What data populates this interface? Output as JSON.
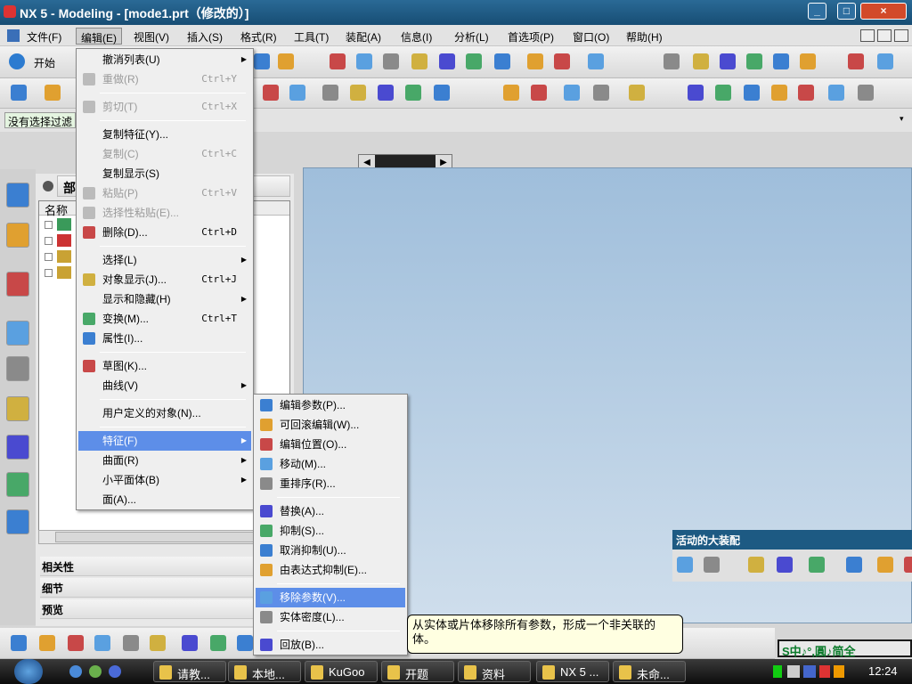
{
  "window": {
    "title": "NX 5 - Modeling - [mode1.prt（修改的）]",
    "controls": [
      "_",
      "□",
      "×"
    ]
  },
  "menubar": {
    "items": [
      "文件(F)",
      "编辑(E)",
      "视图(V)",
      "插入(S)",
      "格式(R)",
      "工具(T)",
      "装配(A)",
      "信息(I)",
      "分析(L)",
      "首选项(P)",
      "窗口(O)",
      "帮助(H)"
    ],
    "active": 1
  },
  "toolbar": {
    "start_label": "开始",
    "filter_text": "没有选择过滤"
  },
  "navigator": {
    "header": "部",
    "column": "名称",
    "sections": [
      "相关性",
      "细节",
      "预览"
    ]
  },
  "edit_menu": [
    {
      "label": "撤消列表(U)",
      "sub": true,
      "icon": null
    },
    {
      "label": "重做(R)",
      "shortcut": "Ctrl+Y",
      "disabled": true,
      "icon": "redo-icon"
    },
    {
      "sep": true
    },
    {
      "label": "剪切(T)",
      "shortcut": "Ctrl+X",
      "disabled": true,
      "icon": "cut-icon"
    },
    {
      "sep": true
    },
    {
      "label": "复制特征(Y)..."
    },
    {
      "label": "复制(C)",
      "shortcut": "Ctrl+C",
      "disabled": true
    },
    {
      "label": "复制显示(S)"
    },
    {
      "label": "粘贴(P)",
      "shortcut": "Ctrl+V",
      "disabled": true,
      "icon": "paste-icon"
    },
    {
      "label": "选择性粘贴(E)...",
      "disabled": true,
      "icon": "paste-special-icon"
    },
    {
      "label": "删除(D)...",
      "shortcut": "Ctrl+D",
      "icon": "delete-icon"
    },
    {
      "sep": true
    },
    {
      "label": "选择(L)",
      "sub": true
    },
    {
      "label": "对象显示(J)...",
      "shortcut": "Ctrl+J",
      "icon": "object-display-icon"
    },
    {
      "label": "显示和隐藏(H)",
      "sub": true
    },
    {
      "label": "变换(M)...",
      "shortcut": "Ctrl+T",
      "icon": "transform-icon"
    },
    {
      "label": "属性(I)...",
      "icon": "properties-icon"
    },
    {
      "sep": true
    },
    {
      "label": "草图(K)...",
      "icon": "sketch-icon"
    },
    {
      "label": "曲线(V)",
      "sub": true
    },
    {
      "sep": true
    },
    {
      "label": "用户定义的对象(N)..."
    },
    {
      "sep": true
    },
    {
      "label": "特征(F)",
      "sub": true,
      "highlighted": true
    },
    {
      "label": "曲面(R)",
      "sub": true
    },
    {
      "label": "小平面体(B)",
      "sub": true
    },
    {
      "label": "面(A)..."
    }
  ],
  "feature_submenu": [
    {
      "label": "编辑参数(P)...",
      "icon": "edit-parameters-icon"
    },
    {
      "label": "可回滚编辑(W)...",
      "icon": "rollback-edit-icon"
    },
    {
      "label": "编辑位置(O)...",
      "icon": "edit-position-icon"
    },
    {
      "label": "移动(M)...",
      "icon": "move-feature-icon"
    },
    {
      "label": "重排序(R)...",
      "icon": "reorder-icon"
    },
    {
      "sep": true
    },
    {
      "label": "替换(A)...",
      "icon": "replace-icon"
    },
    {
      "label": "抑制(S)...",
      "icon": "suppress-icon"
    },
    {
      "label": "取消抑制(U)...",
      "icon": "unsuppress-icon"
    },
    {
      "label": "由表达式抑制(E)...",
      "icon": "suppress-by-expression-icon"
    },
    {
      "sep": true
    },
    {
      "label": "移除参数(V)...",
      "icon": "remove-parameters-icon",
      "highlighted": true
    },
    {
      "label": "实体密度(L)...",
      "icon": "solid-density-icon"
    },
    {
      "sep": true
    },
    {
      "label": "回放(B)...",
      "icon": "playback-icon"
    }
  ],
  "tooltip": "从实体或片体移除所有参数，形成一个非关联的体。",
  "assembly_toolbar": {
    "title": "活动的大装配"
  },
  "ime": "S中♪°,圓♪简全",
  "taskbar": {
    "tasks": [
      "请教...",
      "本地...",
      "KuGoo",
      "开题",
      "资料",
      "NX 5 ...",
      "未命..."
    ],
    "clock": "12:24"
  },
  "colors": {
    "titlebar": "#1d5a83",
    "highlight": "#5d8ee8",
    "viewport": "#b4cde4",
    "tooltip": "#ffffe1"
  }
}
